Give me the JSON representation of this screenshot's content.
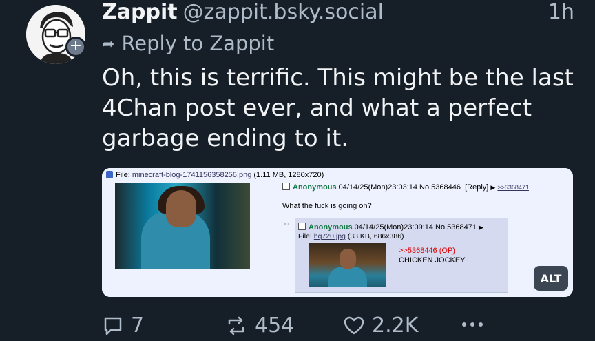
{
  "post": {
    "author": "Zappit",
    "handle": "@zappit.bsky.social",
    "time": "1h",
    "reply_to": "Reply to Zappit",
    "text": "Oh, this is terrific. This might be the last 4Chan post ever, and what a perfect garbage ending to it."
  },
  "embed": {
    "file_label": "File: ",
    "file_name": "minecraft-blog-1741156358256.png",
    "file_meta": " (1.11 MB, 1280x720)",
    "op_name": "Anonymous",
    "op_meta": "04/14/25(Mon)23:03:14 No.5368446",
    "op_reply": "[Reply]",
    "op_backlink": ">>5368471",
    "op_message": "What the fuck is going on?",
    "reply_arrows": ">>",
    "reply_name": "Anonymous",
    "reply_meta": "04/14/25(Mon)23:09:14 No.5368471",
    "reply_file_label": "File: ",
    "reply_file_name": "hq720.jpg",
    "reply_file_meta": " (33 KB, 686x386)",
    "reply_quote": ">>5368446 (OP)",
    "reply_message": "CHICKEN JOCKEY",
    "alt_label": "ALT"
  },
  "actions": {
    "replies": "7",
    "reposts": "454",
    "likes": "2.2K"
  }
}
